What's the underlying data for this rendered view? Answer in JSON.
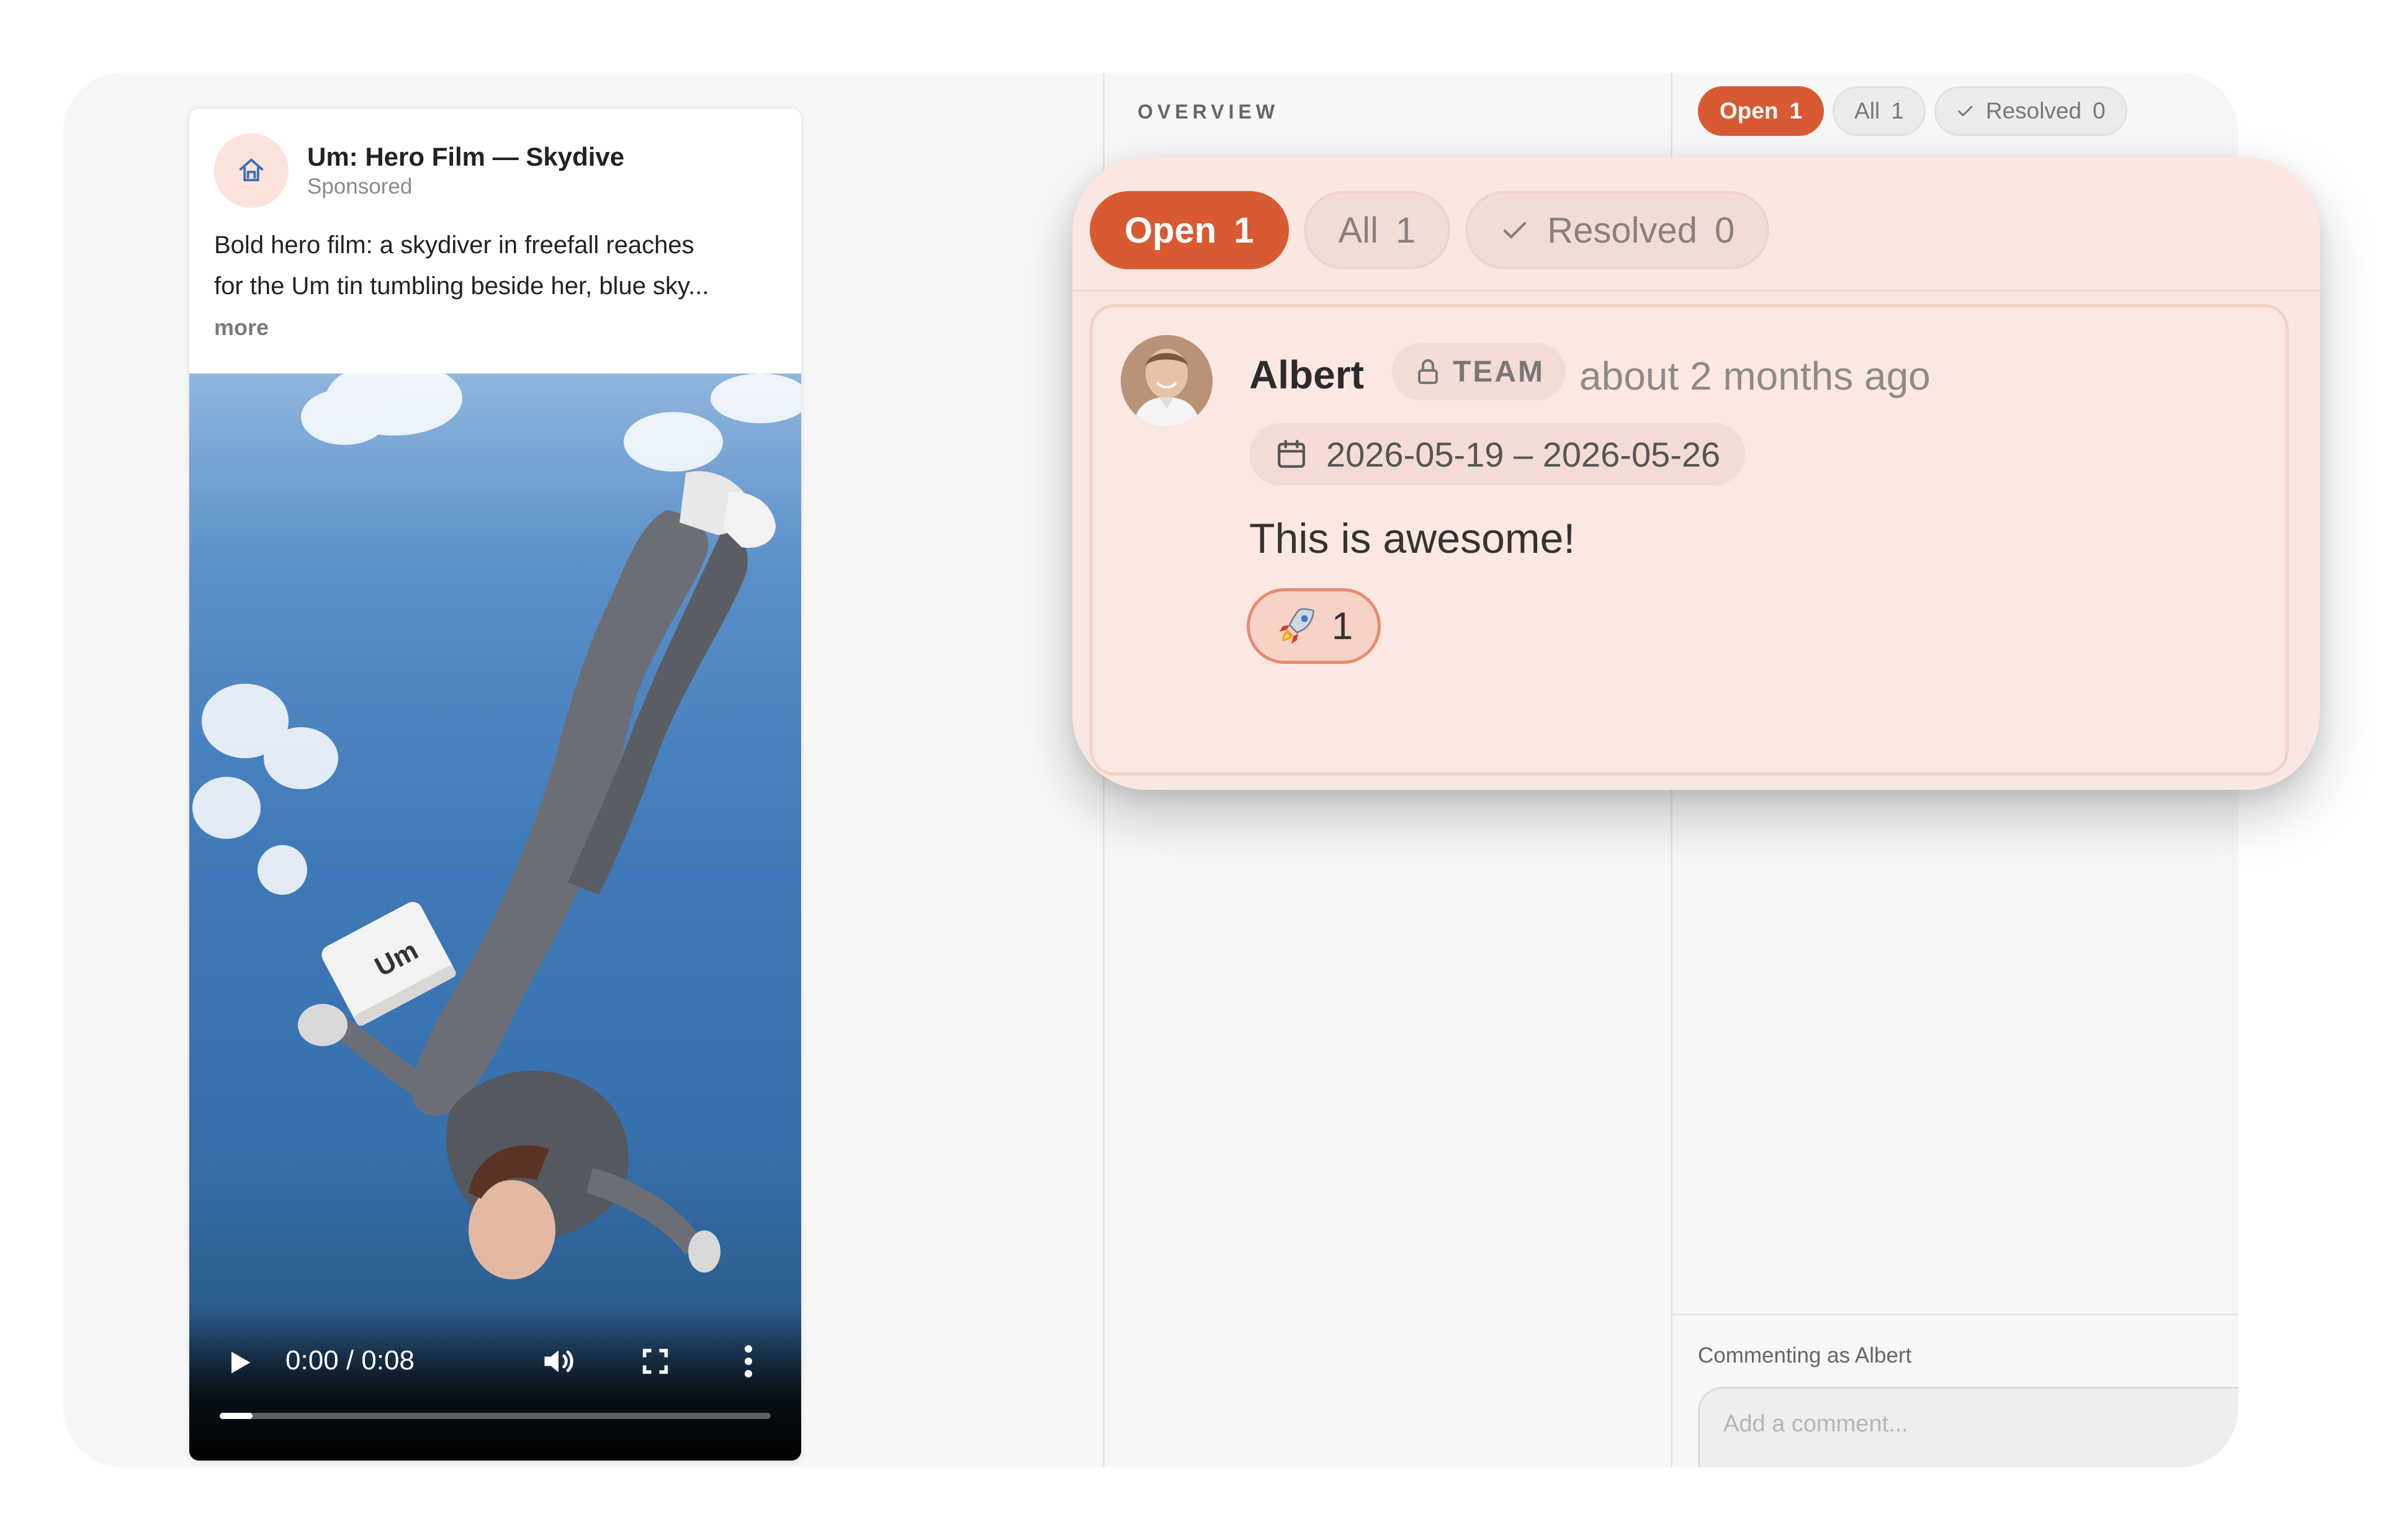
{
  "ad": {
    "brand_name": "Um: Hero Film — Skydive",
    "sponsored": "Sponsored",
    "body_line1": "Bold hero film: a skydiver in freefall reaches",
    "body_line2": "for the Um tin tumbling beside her, blue sky...",
    "more": "more",
    "video": {
      "time": "0:00 / 0:08",
      "tin_label": "Um",
      "progress_fraction": 0.06
    }
  },
  "overview": {
    "label": "OVERVIEW"
  },
  "filter_tabs": {
    "open": {
      "label": "Open",
      "count": "1"
    },
    "all": {
      "label": "All",
      "count": "1"
    },
    "resolved": {
      "label": "Resolved",
      "count": "0"
    }
  },
  "thread": {
    "author": "Albert",
    "badge": "TEAM",
    "time_ago": "about 2 months ago",
    "date_range": "2026-05-19 – 2026-05-26",
    "text": "This is awesome!",
    "reaction": {
      "emoji": "rocket",
      "count": "1"
    }
  },
  "composer": {
    "commenting_as": "Commenting as Albert",
    "placeholder": "Add a comment..."
  },
  "colors": {
    "accent": "#d85a33",
    "popover_bg": "#fbe7e1",
    "panel_bg": "#f7f7f7"
  },
  "icons": [
    "brand-logo-icon",
    "check-icon",
    "lock-icon",
    "calendar-icon",
    "rocket-icon",
    "play-icon",
    "volume-icon",
    "fullscreen-icon",
    "more-vertical-icon"
  ]
}
